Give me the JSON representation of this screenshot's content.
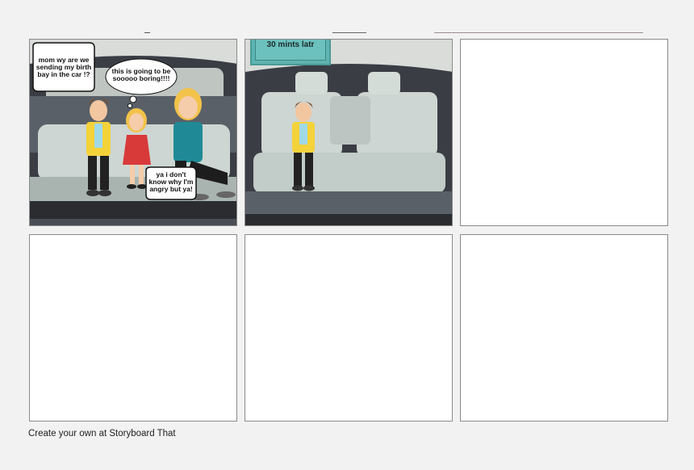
{
  "panels": [
    {
      "speech_bubbles": [
        "mom wy are we sending my birth bay in the car !?",
        "this is going to be sooooo boring!!!!",
        "ya i don't know why I'm angry but ya!"
      ]
    },
    {
      "caption": "30 mints latr"
    },
    {},
    {},
    {},
    {}
  ],
  "footer": {
    "text": "Create your own at Storyboard That"
  },
  "colors": {
    "caption_box": "#5fb3b0",
    "panel_border": "#8a8a8a",
    "car_interior": "#3a3d44",
    "seat": "#cdd6d2"
  }
}
